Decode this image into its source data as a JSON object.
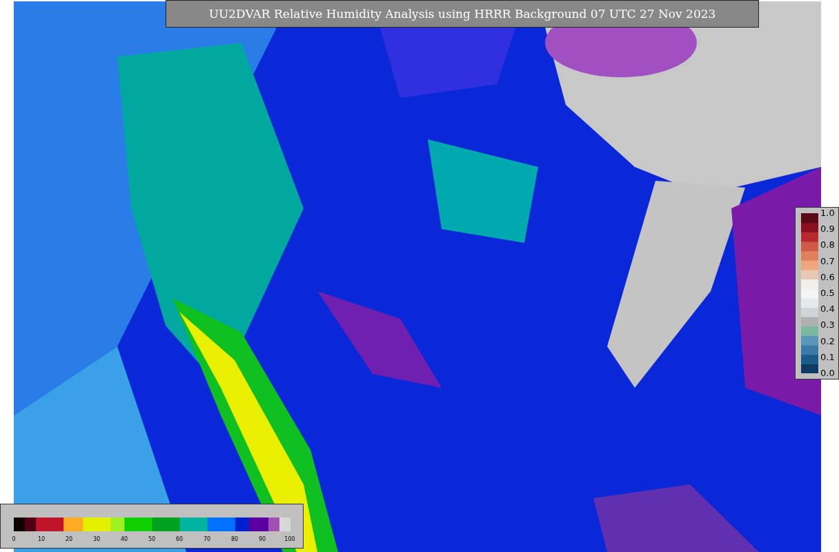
{
  "title": "UU2DVAR Relative Humidity Analysis using HRRR Background 07 UTC 27 Nov 2023",
  "innovation_colorbar": {
    "ticks": [
      "1.0",
      "0.9",
      "0.8",
      "0.7",
      "0.6",
      "0.5",
      "0.4",
      "0.3",
      "0.2",
      "0.1",
      "0.0"
    ]
  },
  "humidity_colorbar": {
    "ticks": [
      "0",
      "10",
      "20",
      "30",
      "40",
      "50",
      "60",
      "70",
      "80",
      "90",
      "100"
    ]
  }
}
